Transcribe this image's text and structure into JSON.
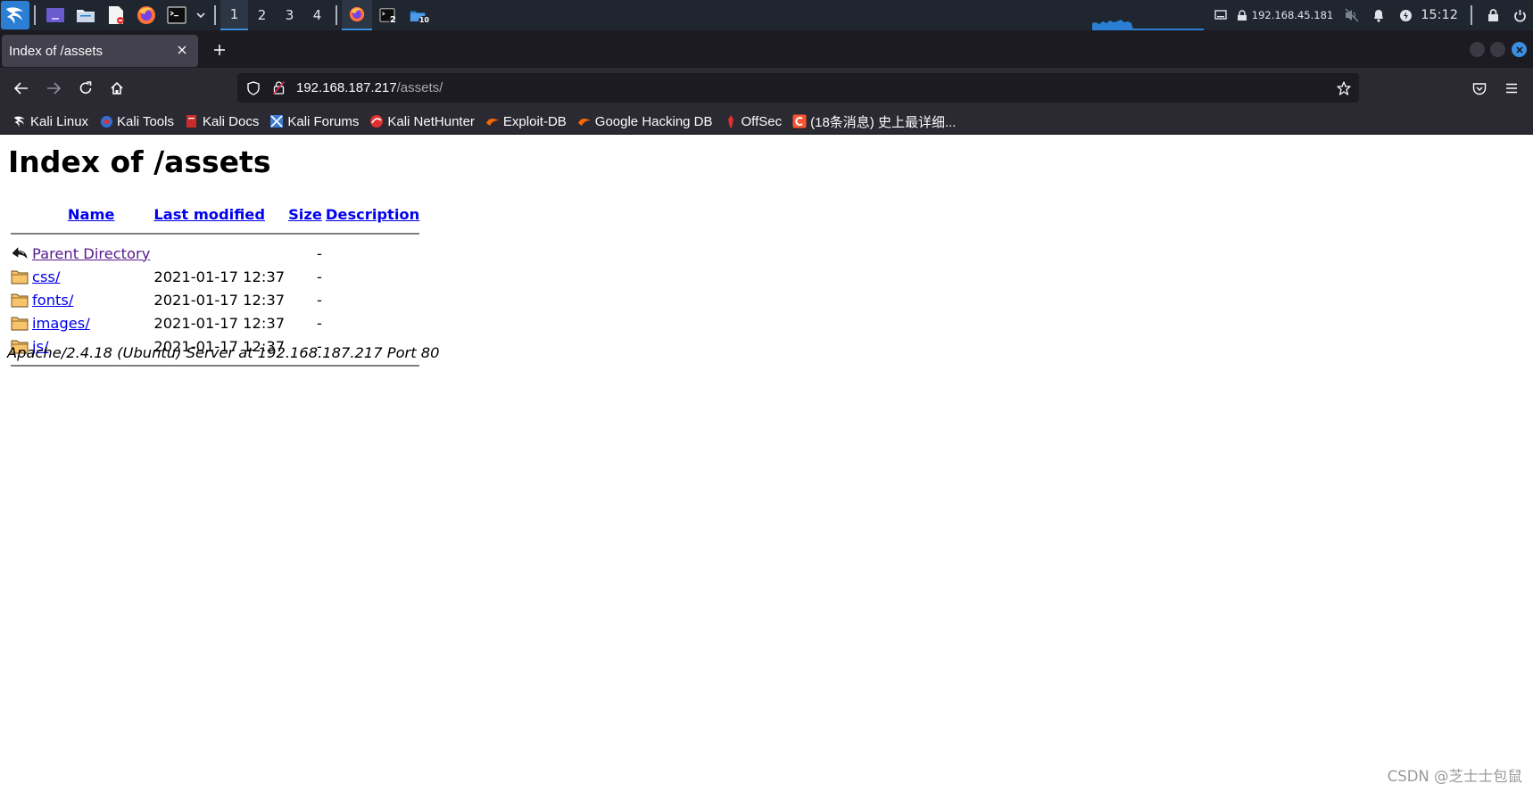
{
  "panel": {
    "workspaces": [
      "1",
      "2",
      "3",
      "4"
    ],
    "terminal_badge": "2",
    "files_badge": "10",
    "ip_address": "192.168.45.181",
    "clock": "15:12"
  },
  "browser": {
    "tab_title": "Index of /assets",
    "url_host": "192.168.187.217",
    "url_path": "/assets/",
    "bookmarks": [
      "Kali Linux",
      "Kali Tools",
      "Kali Docs",
      "Kali Forums",
      "Kali NetHunter",
      "Exploit-DB",
      "Google Hacking DB",
      "OffSec",
      "(18条消息) 史上最详细..."
    ]
  },
  "page": {
    "title": "Index of /assets",
    "columns": {
      "name": "Name",
      "modified": "Last modified",
      "size": "Size",
      "description": "Description"
    },
    "parent": {
      "name": "Parent Directory",
      "modified": "",
      "size": "-"
    },
    "rows": [
      {
        "name": "css/",
        "modified": "2021-01-17 12:37",
        "size": "-"
      },
      {
        "name": "fonts/",
        "modified": "2021-01-17 12:37",
        "size": "-"
      },
      {
        "name": "images/",
        "modified": "2021-01-17 12:37",
        "size": "-"
      },
      {
        "name": "js/",
        "modified": "2021-01-17 12:37",
        "size": "-"
      }
    ],
    "server_signature": "Apache/2.4.18 (Ubuntu) Server at 192.168.187.217 Port 80"
  },
  "watermark": "CSDN @芝士士包鼠",
  "colors": {
    "panel_bg": "#1f2630",
    "firefox_toolbar": "#2b2a33",
    "link": "#0000ee",
    "visited_link": "#551a8b",
    "accent": "#3a8fe0"
  }
}
